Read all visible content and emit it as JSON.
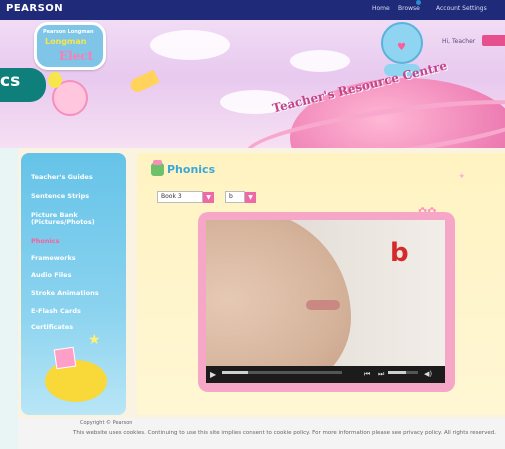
{
  "topbar": {
    "brand": "PEARSON",
    "links": [
      "Home",
      "Browse",
      "Account Settings"
    ]
  },
  "header": {
    "logo_small": "Pearson Longman",
    "logo_mid": "Longman",
    "logo_big": "Elect",
    "banner_title": "Teacher's Resource Centre",
    "greeting": "Hi, Teacher"
  },
  "section_tab": "cs",
  "sidebar": {
    "items": [
      {
        "label": "Teacher's Guides",
        "active": false
      },
      {
        "label": "Sentence Strips",
        "active": false
      },
      {
        "label": "Picture Bank (Pictures/Photos)",
        "active": false
      },
      {
        "label": "Phonics",
        "active": true
      },
      {
        "label": "Frameworks",
        "active": false
      },
      {
        "label": "Audio Files",
        "active": false
      },
      {
        "label": "Stroke Animations",
        "active": false
      },
      {
        "label": "E-Flash Cards",
        "active": false
      },
      {
        "label": "Certificates",
        "active": false
      }
    ]
  },
  "main": {
    "title": "Phonics",
    "book_select": "Book 3",
    "letter_select": "b",
    "video_letter": "b",
    "progress": 0.22,
    "volume": 0.6
  },
  "footer": {
    "line1": "Copyright © Pearson",
    "line2": "This website uses cookies. Continuing to use this site implies consent to cookie policy. For more information please see privacy policy. All rights reserved."
  },
  "colors": {
    "topbar": "#1f2a78",
    "tab": "#0f7f7b",
    "accent_pink": "#ee6aa6",
    "sidebar_blue": "#65c3e8",
    "title_blue": "#39a8d8",
    "letter_red": "#d62a2a"
  }
}
